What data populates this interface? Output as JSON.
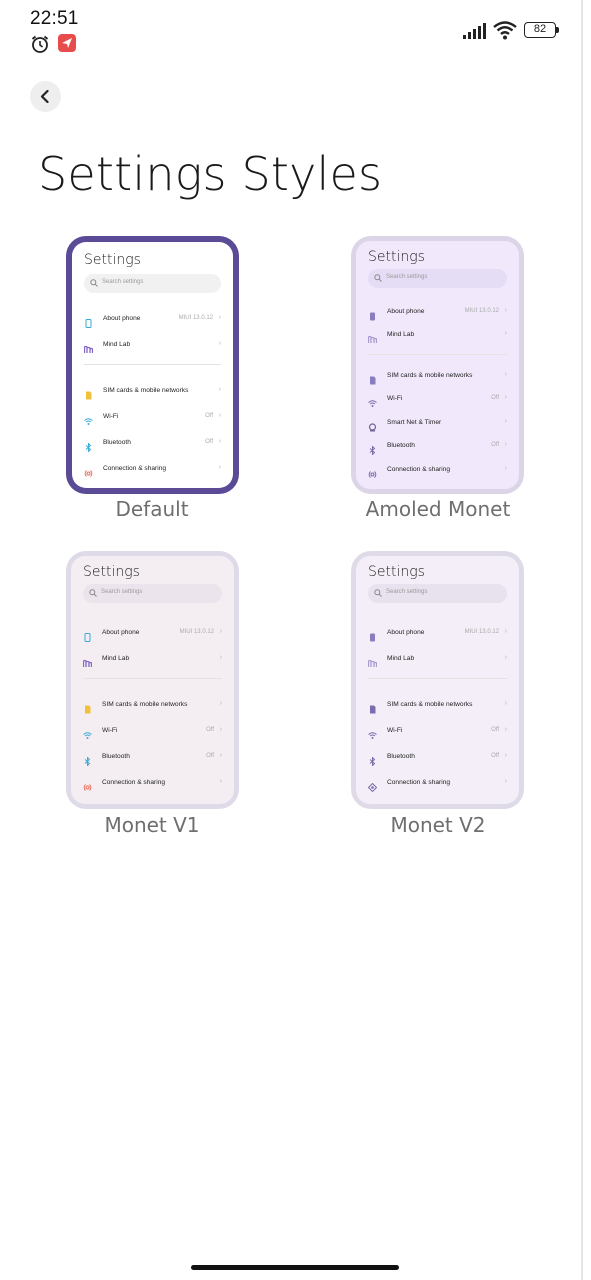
{
  "status_bar": {
    "time": "22:51",
    "battery": "82",
    "icons": [
      "alarm-icon",
      "app-notification-icon",
      "signal-icon",
      "wifi-icon",
      "battery-icon"
    ]
  },
  "back_button": {
    "icon": "chevron-left-icon"
  },
  "page": {
    "title": "Settings Styles"
  },
  "preview": {
    "title": "Settings",
    "search_placeholder": "Search settings",
    "about_phone": "About phone",
    "about_phone_value": "MIUI 13.0.12",
    "mind_lab": "Mind Lab",
    "sim": "SIM cards & mobile networks",
    "wifi": "Wi-Fi",
    "wifi_value": "Off",
    "smart_net": "Smart Net & Timer",
    "bluetooth": "Bluetooth",
    "bluetooth_value": "Off",
    "connection": "Connection & sharing"
  },
  "styles": [
    {
      "label": "Default",
      "selected": true
    },
    {
      "label": "Amoled Monet",
      "selected": false
    },
    {
      "label": "Monet V1",
      "selected": false
    },
    {
      "label": "Monet V2",
      "selected": false
    }
  ],
  "colors": {
    "selected_border": "#5b4a95",
    "unselected_border": "#dcd5e8",
    "label_text": "#6e6e6e"
  }
}
